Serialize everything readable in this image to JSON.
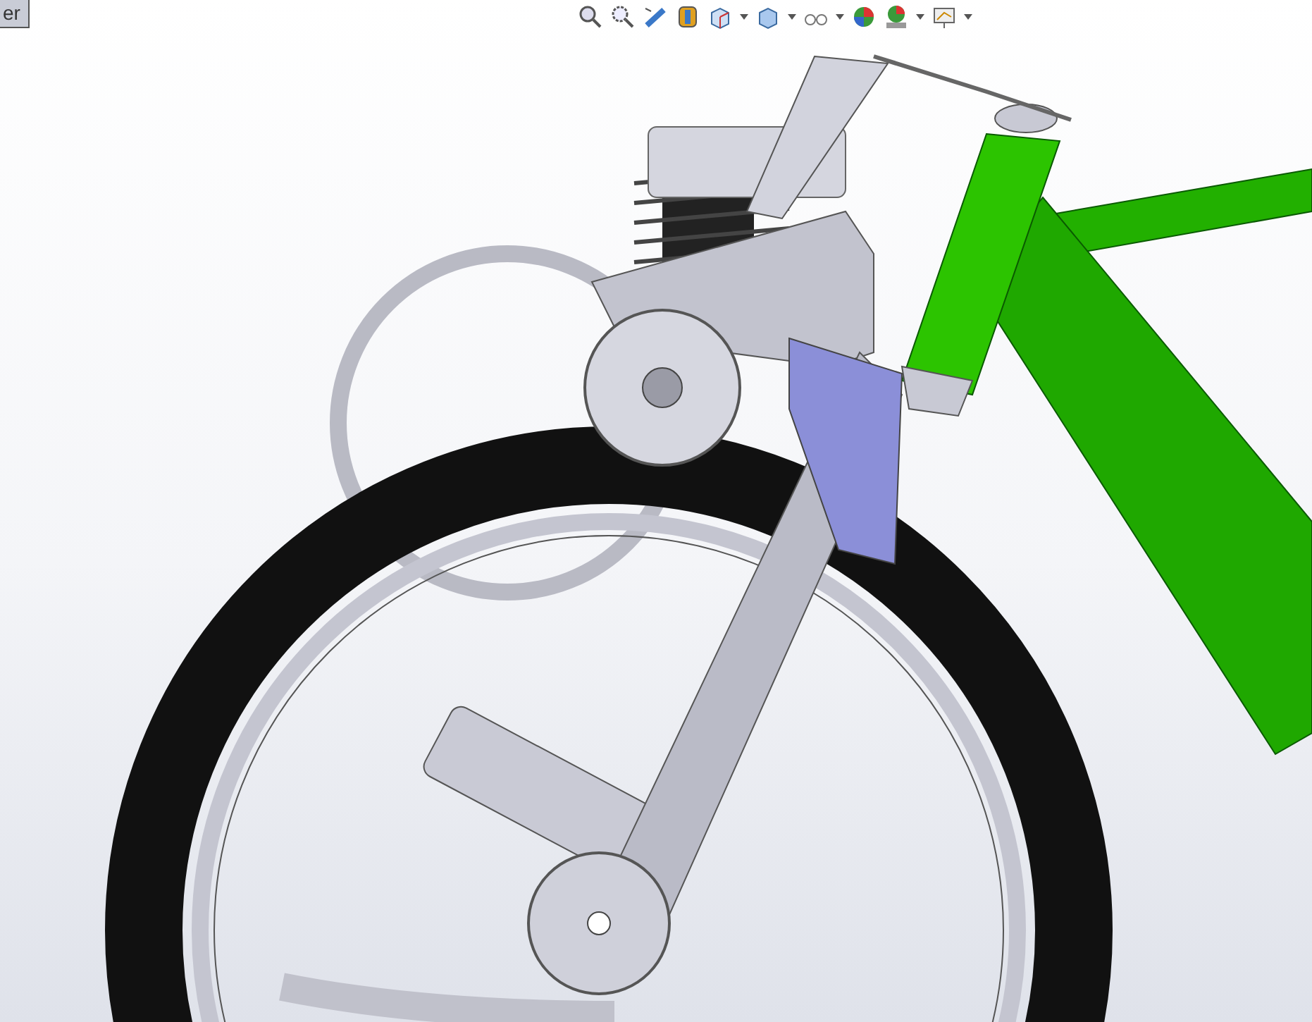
{
  "viewport": {
    "tab_label": "er"
  }
}
